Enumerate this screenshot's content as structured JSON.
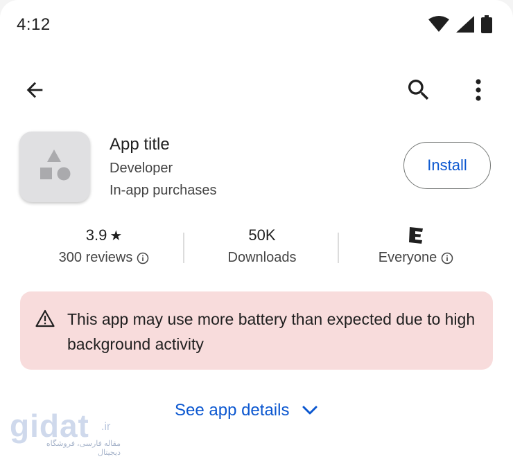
{
  "status_bar": {
    "time": "4:12",
    "icons": [
      "wifi-icon",
      "cell-signal-icon",
      "battery-icon"
    ]
  },
  "top_bar": {
    "back_icon": "arrow-back-icon",
    "search_icon": "search-icon",
    "more_icon": "more-vert-icon"
  },
  "app": {
    "title": "App title",
    "developer": "Developer",
    "purchases": "In-app purchases",
    "install_label": "Install",
    "icon": "shapes-placeholder-icon"
  },
  "stats": {
    "rating": "3.9",
    "rating_star": "★",
    "reviews": "300 reviews",
    "downloads": "50K",
    "downloads_label": "Downloads",
    "content_rating": "Everyone"
  },
  "warning": {
    "icon": "warning-icon",
    "text": "This app may use more battery than expected due to high background activity"
  },
  "details": {
    "label": "See app details",
    "icon": "chevron-down-icon"
  },
  "watermark": {
    "word": "gidat",
    "tld": ".ir",
    "subtitle": "مقاله فارسی، فروشگاه دیجیتال"
  },
  "colors": {
    "accent": "#0b57d0",
    "warning_bg": "#f8dcdc",
    "icon_bg": "#e0e0e2"
  }
}
